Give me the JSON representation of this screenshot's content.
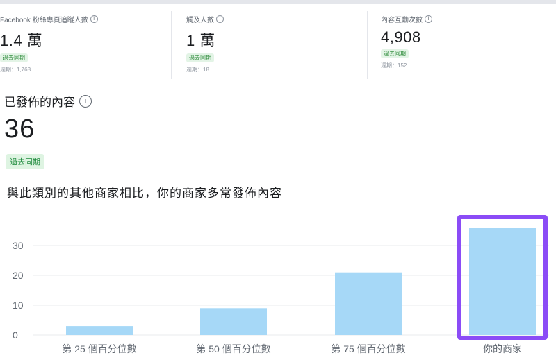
{
  "stats": [
    {
      "label": "Facebook 粉絲專頁追蹤人數",
      "value": "1.4 萬",
      "badge": "過去同期",
      "sub": "週期：1,768"
    },
    {
      "label": "觸及人數",
      "value": "1 萬",
      "badge": "過去同期",
      "sub": "週期：18"
    },
    {
      "label": "內容互動次數",
      "value": "4,908",
      "badge": "過去同期",
      "sub": "週期：152"
    }
  ],
  "published": {
    "title": "已發佈的內容",
    "count": "36",
    "badge": "過去同期",
    "comparison": "與此類別的其他商家相比，你的商家多常發佈內容"
  },
  "chart_data": {
    "type": "bar",
    "categories": [
      "第 25 個百分位數",
      "第 50 個百分位數",
      "第 75 個百分位數",
      "你的商家"
    ],
    "values": [
      3,
      9,
      21,
      36
    ],
    "yticks": [
      0,
      10,
      20,
      30
    ],
    "ylim": [
      0,
      38
    ],
    "highlight_index": 3,
    "colors": {
      "bar": "#a6d8f7",
      "highlight_border": "#8b4cf6",
      "grid": "#e9ebee"
    }
  }
}
